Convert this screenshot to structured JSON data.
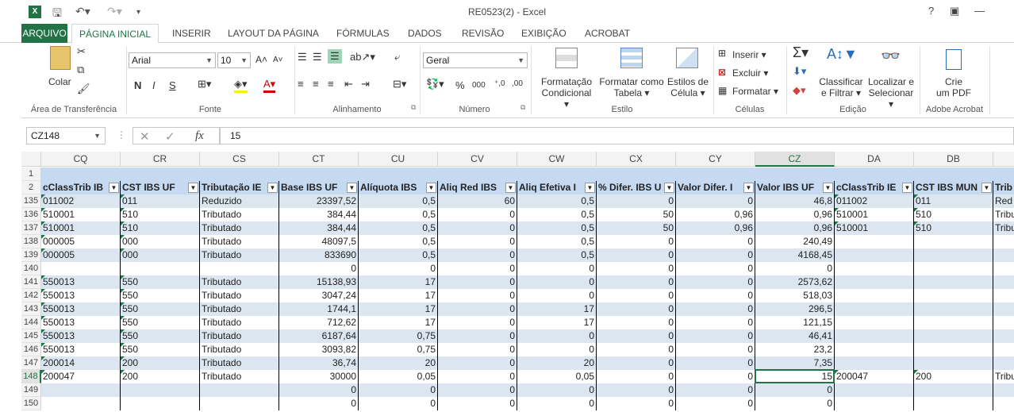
{
  "app": {
    "title": "RE0523(2) - Excel",
    "logo": "X",
    "window_buttons": [
      "?",
      "▣",
      "—"
    ]
  },
  "tabs": [
    "ARQUIVO",
    "PÁGINA INICIAL",
    "INSERIR",
    "LAYOUT DA PÁGINA",
    "FÓRMULAS",
    "DADOS",
    "REVISÃO",
    "EXIBIÇÃO",
    "ACROBAT"
  ],
  "ribbon": {
    "clipboard": {
      "paste": "Colar",
      "label": "Área de Transferência"
    },
    "font": {
      "name": "Arial",
      "size": "10",
      "bold": "N",
      "italic": "I",
      "underline": "S",
      "label": "Fonte"
    },
    "alignment": {
      "label": "Alinhamento"
    },
    "number": {
      "format": "Geral",
      "label": "Número",
      "percent": "%",
      "thousands": "000"
    },
    "styles": {
      "cond_1": "Formatação",
      "cond_2": "Condicional ▾",
      "table_1": "Formatar como",
      "table_2": "Tabela ▾",
      "cell_1": "Estilos de",
      "cell_2": "Célula ▾",
      "label": "Estilo"
    },
    "cells": {
      "insert": "Inserir ▾",
      "delete": "Excluir ▾",
      "format": "Formatar ▾",
      "label": "Células"
    },
    "editing": {
      "sort_1": "Classificar",
      "sort_2": "e Filtrar ▾",
      "find_1": "Localizar e",
      "find_2": "Selecionar ▾",
      "label": "Edição"
    },
    "acrobat": {
      "btn_1": "Crie",
      "btn_2": "um PDF",
      "label": "Adobe Acrobat"
    }
  },
  "formula_bar": {
    "name_box": "CZ148",
    "formula": "15",
    "fx": "fx"
  },
  "grid": {
    "columns": [
      "CQ",
      "CR",
      "CS",
      "CT",
      "CU",
      "CV",
      "CW",
      "CX",
      "CY",
      "CZ",
      "DA",
      "DB",
      ""
    ],
    "selected_column": "CZ",
    "header_row_label": "2",
    "headers": [
      "cClassTrib IB",
      "CST IBS UF",
      "Tributação IE",
      "Base IBS UF",
      "Alíquota IBS",
      "Aliq Red IBS",
      "Aliq Efetiva I",
      "% Difer. IBS U",
      "Valor Difer. I",
      "Valor IBS UF",
      "cClassTrib IE",
      "CST IBS MUN",
      "Trib"
    ],
    "rows": [
      {
        "n": "135",
        "c": [
          "011002",
          "011",
          "Reduzido",
          "23397,52",
          "0,5",
          "60",
          "0,5",
          "0",
          "0",
          "46,8",
          "011002",
          "011",
          "Red"
        ]
      },
      {
        "n": "136",
        "c": [
          "510001",
          "510",
          "Tributado",
          "384,44",
          "0,5",
          "0",
          "0,5",
          "50",
          "0,96",
          "0,96",
          "510001",
          "510",
          "Tribu"
        ]
      },
      {
        "n": "137",
        "c": [
          "510001",
          "510",
          "Tributado",
          "384,44",
          "0,5",
          "0",
          "0,5",
          "50",
          "0,96",
          "0,96",
          "510001",
          "510",
          "Tribu"
        ]
      },
      {
        "n": "138",
        "c": [
          "000005",
          "000",
          "Tributado",
          "48097,5",
          "0,5",
          "0",
          "0,5",
          "0",
          "0",
          "240,49",
          "",
          "",
          ""
        ]
      },
      {
        "n": "139",
        "c": [
          "000005",
          "000",
          "Tributado",
          "833690",
          "0,5",
          "0",
          "0,5",
          "0",
          "0",
          "4168,45",
          "",
          "",
          ""
        ]
      },
      {
        "n": "140",
        "c": [
          "",
          "",
          "",
          "0",
          "0",
          "0",
          "0",
          "0",
          "0",
          "0",
          "",
          "",
          ""
        ]
      },
      {
        "n": "141",
        "c": [
          "550013",
          "550",
          "Tributado",
          "15138,93",
          "17",
          "0",
          "0",
          "0",
          "0",
          "2573,62",
          "",
          "",
          ""
        ]
      },
      {
        "n": "142",
        "c": [
          "550013",
          "550",
          "Tributado",
          "3047,24",
          "17",
          "0",
          "0",
          "0",
          "0",
          "518,03",
          "",
          "",
          ""
        ]
      },
      {
        "n": "143",
        "c": [
          "550013",
          "550",
          "Tributado",
          "1744,1",
          "17",
          "0",
          "17",
          "0",
          "0",
          "296,5",
          "",
          "",
          ""
        ]
      },
      {
        "n": "144",
        "c": [
          "550013",
          "550",
          "Tributado",
          "712,62",
          "17",
          "0",
          "17",
          "0",
          "0",
          "121,15",
          "",
          "",
          ""
        ]
      },
      {
        "n": "145",
        "c": [
          "550013",
          "550",
          "Tributado",
          "6187,64",
          "0,75",
          "0",
          "0",
          "0",
          "0",
          "46,41",
          "",
          "",
          ""
        ]
      },
      {
        "n": "146",
        "c": [
          "550013",
          "550",
          "Tributado",
          "3093,82",
          "0,75",
          "0",
          "0",
          "0",
          "0",
          "23,2",
          "",
          "",
          ""
        ]
      },
      {
        "n": "147",
        "c": [
          "200014",
          "200",
          "Tributado",
          "36,74",
          "20",
          "0",
          "20",
          "0",
          "0",
          "7,35",
          "",
          "",
          ""
        ]
      },
      {
        "n": "148",
        "c": [
          "200047",
          "200",
          "Tributado",
          "30000",
          "0,05",
          "0",
          "0,05",
          "0",
          "0",
          "15",
          "200047",
          "200",
          "Tribu"
        ]
      },
      {
        "n": "149",
        "c": [
          "",
          "",
          "",
          "0",
          "0",
          "0",
          "0",
          "0",
          "0",
          "0",
          "",
          "",
          ""
        ]
      },
      {
        "n": "150",
        "c": [
          "",
          "",
          "",
          "0",
          "0",
          "0",
          "0",
          "0",
          "0",
          "0",
          "",
          "",
          ""
        ]
      }
    ],
    "selected_row": "148"
  }
}
